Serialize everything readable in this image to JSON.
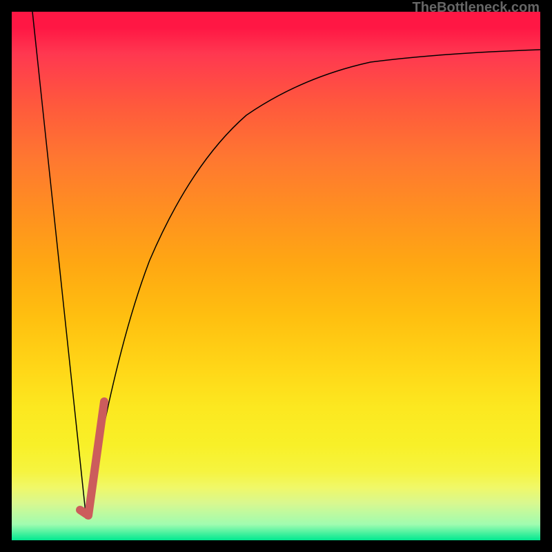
{
  "watermark": "TheBottleneck.com",
  "chart_data": {
    "type": "line",
    "title": "",
    "xlabel": "",
    "ylabel": "",
    "xlim": [
      0,
      100
    ],
    "ylim": [
      0,
      100
    ],
    "series": [
      {
        "name": "left-line",
        "type": "line",
        "color": "#000000",
        "x": [
          4,
          14
        ],
        "y": [
          100,
          4
        ]
      },
      {
        "name": "right-curve",
        "type": "line",
        "color": "#000000",
        "x": [
          14,
          20,
          25,
          30,
          35,
          40,
          50,
          60,
          70,
          80,
          90,
          100
        ],
        "y": [
          4,
          33,
          48,
          58,
          65,
          70,
          78,
          83,
          86,
          88,
          89.5,
          90.5
        ]
      },
      {
        "name": "highlight-segment",
        "type": "line",
        "color": "#cc5c5c",
        "stroke_width": 12,
        "x": [
          13,
          14.5,
          17.5
        ],
        "y": [
          5.5,
          4.5,
          26
        ]
      }
    ],
    "background_gradient": {
      "stops": [
        {
          "pos": 0.0,
          "color": "#ff1744"
        },
        {
          "pos": 0.5,
          "color": "#ffb010"
        },
        {
          "pos": 0.82,
          "color": "#f8f028"
        },
        {
          "pos": 1.0,
          "color": "#00e890"
        }
      ]
    }
  }
}
